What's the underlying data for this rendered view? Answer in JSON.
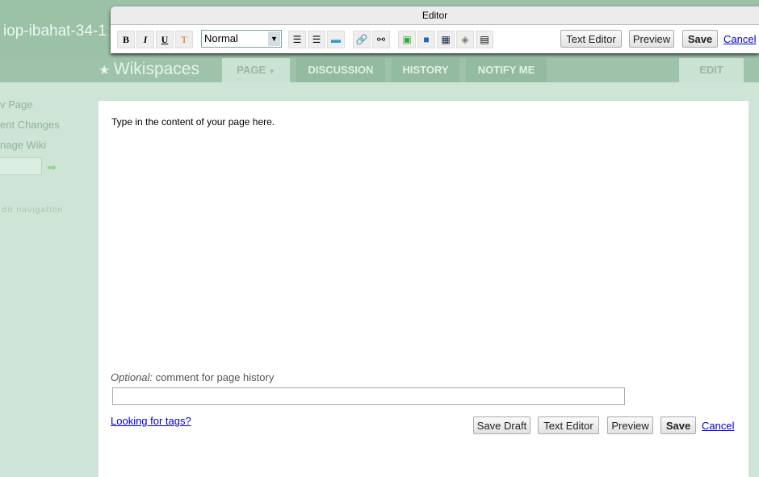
{
  "site": {
    "name": "iop-ibahat-34-1",
    "brand": "Wikispaces"
  },
  "tabs": [
    {
      "label": "PAGE"
    },
    {
      "label": "DISCUSSION"
    },
    {
      "label": "HISTORY"
    },
    {
      "label": "NOTIFY ME"
    },
    {
      "label": "EDIT"
    }
  ],
  "sidebar": {
    "items": [
      "v Page",
      "ent Changes",
      "nage Wiki"
    ],
    "edit_nav": "dit navigation"
  },
  "editor": {
    "title": "Editor",
    "format_value": "Normal",
    "text_editor": "Text Editor",
    "preview": "Preview",
    "save": "Save",
    "cancel": "Cancel"
  },
  "page": {
    "content": "Type in the content of your page here.",
    "optional_label": "Optional:",
    "comment_label": "comment for page history",
    "comment_value": "",
    "tags_link": "Looking for tags?",
    "save_draft": "Save Draft",
    "text_editor": "Text Editor",
    "preview": "Preview",
    "save": "Save",
    "cancel": "Cancel"
  }
}
